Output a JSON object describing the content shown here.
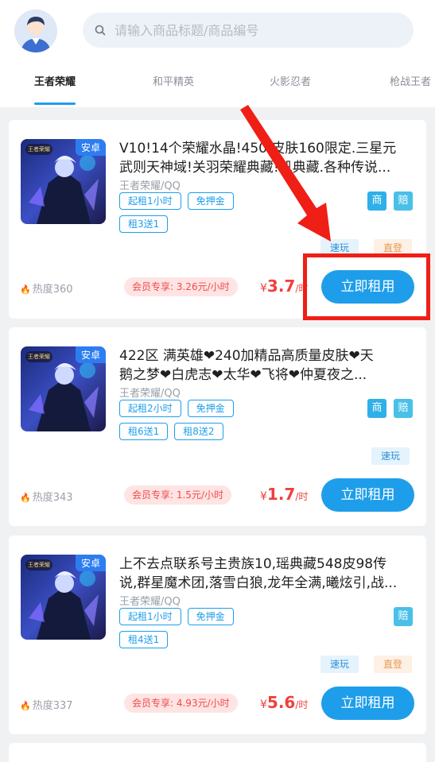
{
  "search": {
    "placeholder": "请输入商品标题/商品编号"
  },
  "tabs": [
    {
      "label": "王者荣耀",
      "active": true
    },
    {
      "label": "和平精英",
      "active": false
    },
    {
      "label": "火影忍者",
      "active": false
    },
    {
      "label": "枪战王者",
      "active": false
    }
  ],
  "cards": [
    {
      "badge": "安卓",
      "title_line1": "V10!14个荣耀水晶!450 皮肤160限定.三星元",
      "title_line2": "武则天神域!关羽荣耀典藏!凯典藏.各种传说...",
      "platform": "王者荣耀/QQ",
      "tags_row1": [
        "起租1小时",
        "免押金"
      ],
      "tags_row2": [
        "租3送1"
      ],
      "icons": [
        "商",
        "赔"
      ],
      "chips": [
        "速玩",
        "直登"
      ],
      "heat": "热度360",
      "vip": "会员专享: 3.26元/小时",
      "price_currency": "¥",
      "price_value": "3.7",
      "price_unit": "/时",
      "rent_label": "立即租用"
    },
    {
      "badge": "安卓",
      "title_line1": "422区 满英雄❤240加精品高质量皮肤❤天",
      "title_line2": "鹅之梦❤白虎志❤太华❤飞将❤仲夏夜之...",
      "platform": "王者荣耀/QQ",
      "tags_row1": [
        "起租2小时",
        "免押金"
      ],
      "tags_row2": [
        "租6送1",
        "租8送2"
      ],
      "icons": [
        "商",
        "赔"
      ],
      "chips": [
        "速玩"
      ],
      "heat": "热度343",
      "vip": "会员专享: 1.5元/小时",
      "price_currency": "¥",
      "price_value": "1.7",
      "price_unit": "/时",
      "rent_label": "立即租用"
    },
    {
      "badge": "安卓",
      "title_line1": "上不去点联系号主贵族10,瑶典藏548皮98传",
      "title_line2": "说,群星魔术团,落雪白狼,龙年全满,曦炫引,战...",
      "platform": "王者荣耀/QQ",
      "tags_row1": [
        "起租1小时",
        "免押金"
      ],
      "tags_row2": [
        "租4送1"
      ],
      "icons": [
        "赔"
      ],
      "chips": [
        "速玩",
        "直登"
      ],
      "heat": "热度337",
      "vip": "会员专享: 4.93元/小时",
      "price_currency": "¥",
      "price_value": "5.6",
      "price_unit": "/时",
      "rent_label": "立即租用"
    }
  ],
  "colors": {
    "accent": "#1e9eea",
    "price": "#f0403d",
    "annotation": "#ef1f16"
  }
}
